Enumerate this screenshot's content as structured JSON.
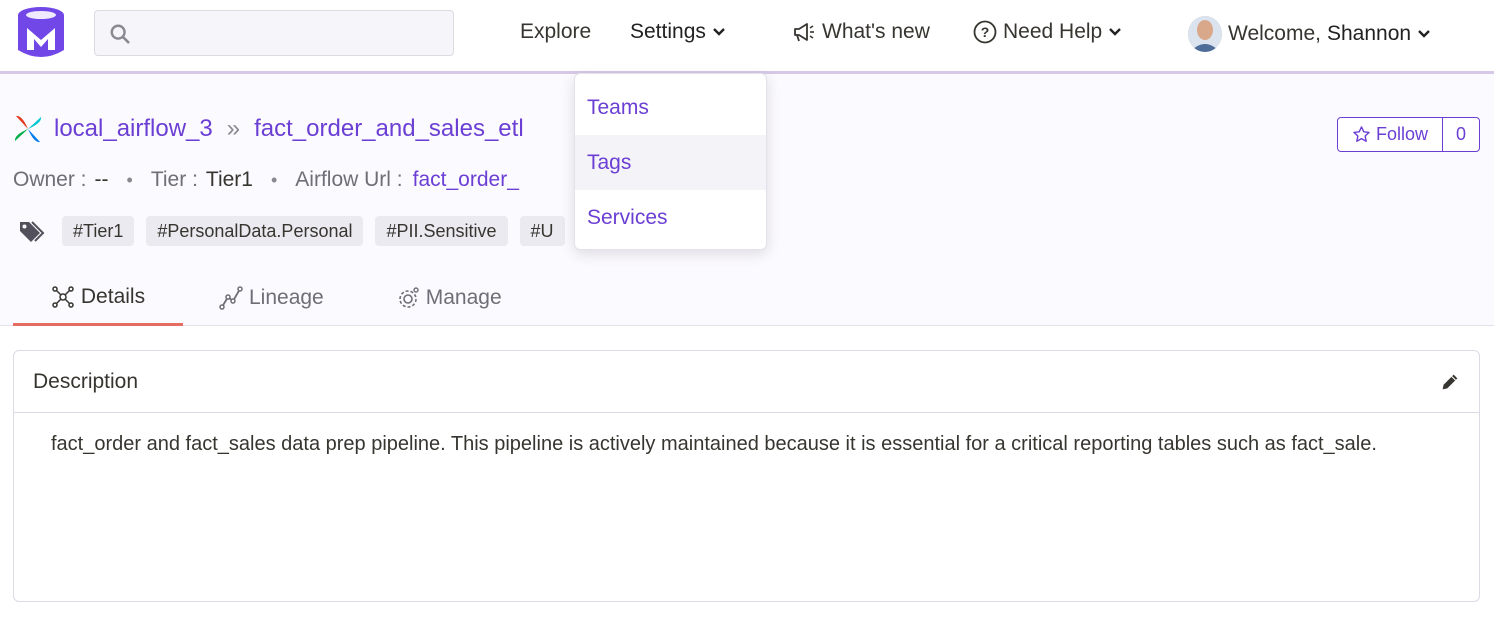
{
  "nav": {
    "explore": "Explore",
    "settings": "Settings",
    "whats_new": "What's new",
    "need_help": "Need Help",
    "welcome": "Welcome,",
    "user_name": "Shannon"
  },
  "settings_menu": {
    "items": [
      "Teams",
      "Tags",
      "Services"
    ]
  },
  "breadcrumb": {
    "service": "local_airflow_3",
    "pipeline": "fact_order_and_sales_etl"
  },
  "meta": {
    "owner_label": "Owner :",
    "owner_value": "--",
    "tier_label": "Tier :",
    "tier_value": "Tier1",
    "airflow_url_label": "Airflow Url :",
    "airflow_url_value": "fact_order_"
  },
  "tags": [
    "#Tier1",
    "#PersonalData.Personal",
    "#PII.Sensitive",
    "#U"
  ],
  "follow": {
    "label": "Follow",
    "count": "0"
  },
  "tabs": [
    "Details",
    "Lineage",
    "Manage"
  ],
  "description": {
    "title": "Description",
    "text": "fact_order and fact_sales data prep pipeline. This pipeline is actively maintained because it is essential for a critical reporting tables such as fact_sale."
  },
  "colors": {
    "accent": "#6b3fd4",
    "tab_underline": "#e56c62",
    "nav_border": "#d7c9e6"
  }
}
